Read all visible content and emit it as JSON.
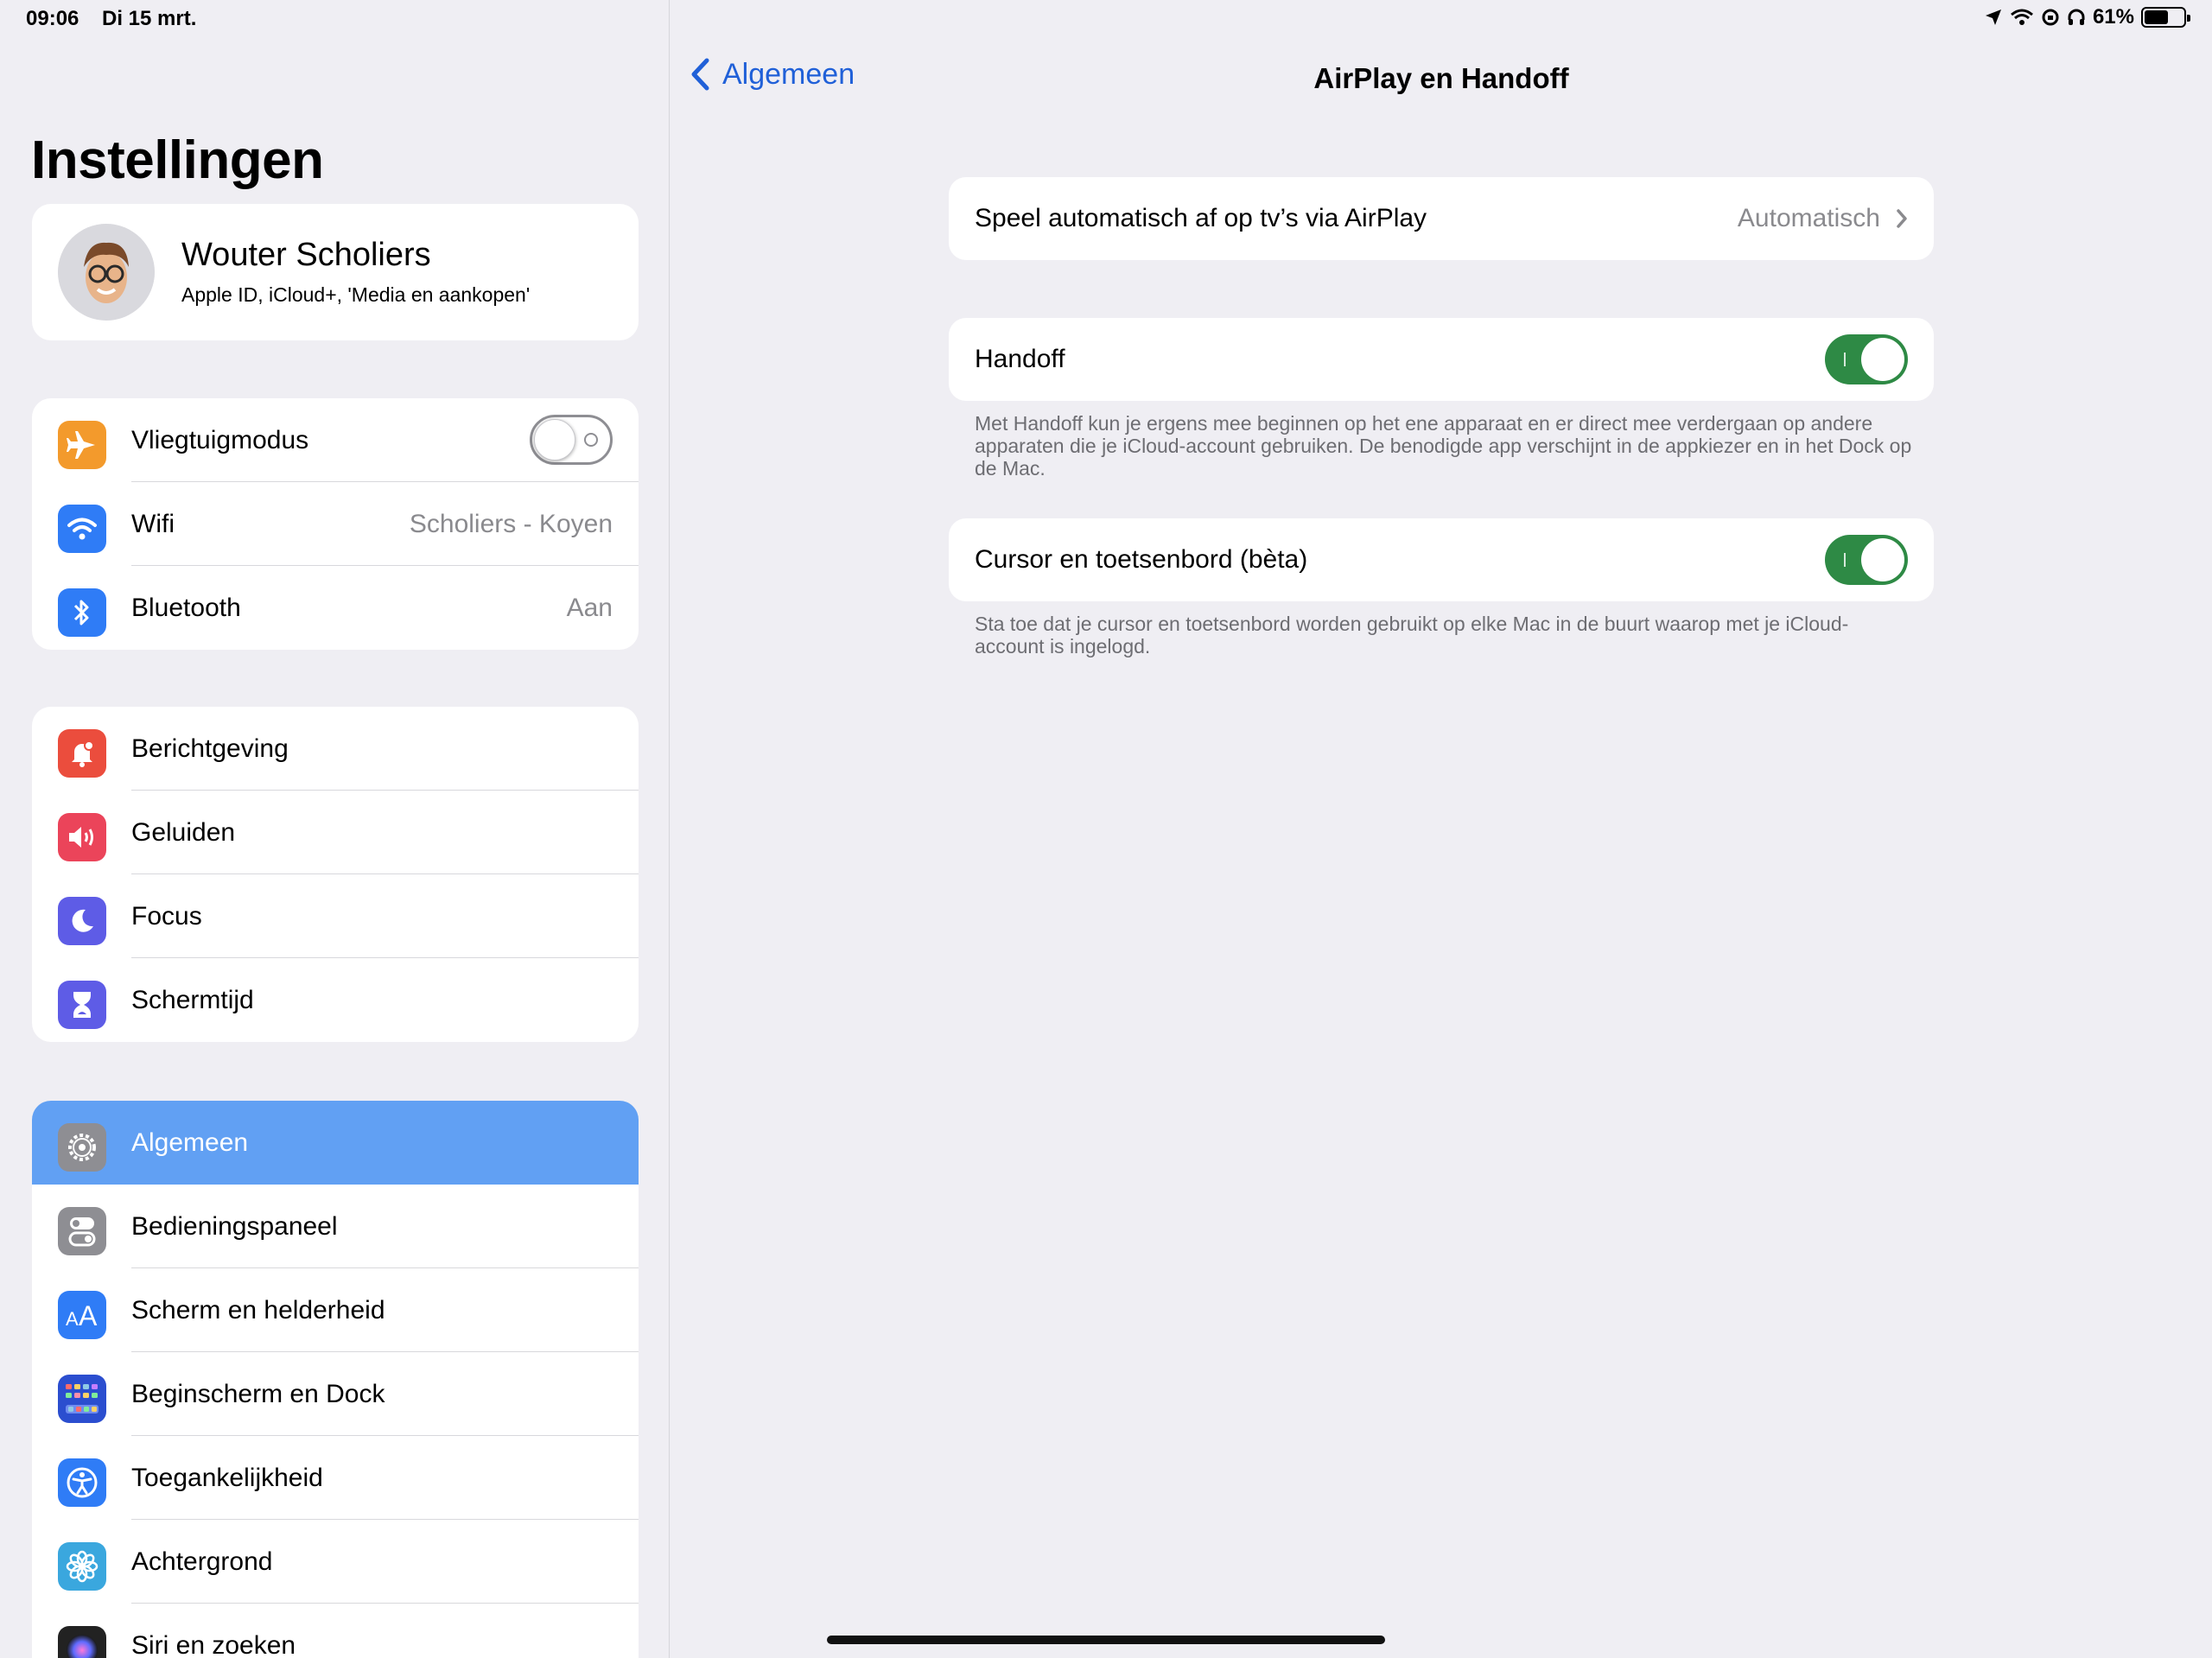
{
  "status": {
    "time": "09:06",
    "date": "Di 15 mrt.",
    "battery_percent": "61%",
    "battery_level": 0.61
  },
  "sidebar": {
    "title": "Instellingen",
    "profile": {
      "name": "Wouter Scholiers",
      "subtitle": "Apple ID, iCloud+, 'Media en aankopen'"
    },
    "group1": [
      {
        "label": "Vliegtuigmodus",
        "value": "",
        "icon": "airplane-icon",
        "color": "#f39a2c"
      },
      {
        "label": "Wifi",
        "value": "Scholiers - Koyen",
        "icon": "wifi-icon",
        "color": "#2f7cf6"
      },
      {
        "label": "Bluetooth",
        "value": "Aan",
        "icon": "bluetooth-icon",
        "color": "#2f7cf6"
      }
    ],
    "group2": [
      {
        "label": "Berichtgeving",
        "icon": "bell-icon",
        "color": "#eb4d3d"
      },
      {
        "label": "Geluiden",
        "icon": "speaker-icon",
        "color": "#eb445a"
      },
      {
        "label": "Focus",
        "icon": "moon-icon",
        "color": "#5e5ce6"
      },
      {
        "label": "Schermtijd",
        "icon": "hourglass-icon",
        "color": "#5e5ce6"
      }
    ],
    "group3": [
      {
        "label": "Algemeen",
        "icon": "gear-icon",
        "color": "#8e8e93"
      },
      {
        "label": "Bedieningspaneel",
        "icon": "switches-icon",
        "color": "#8e8e93"
      },
      {
        "label": "Scherm en helderheid",
        "icon": "text-size-icon",
        "color": "#2f7cf6"
      },
      {
        "label": "Beginscherm en Dock",
        "icon": "home-grid-icon",
        "color": "#2b4ecf"
      },
      {
        "label": "Toegankelijkheid",
        "icon": "accessibility-icon",
        "color": "#2f7cf6"
      },
      {
        "label": "Achtergrond",
        "icon": "flower-icon",
        "color": "#3aa7de"
      },
      {
        "label": "Siri en zoeken",
        "icon": "siri-icon",
        "color": "#222222"
      }
    ]
  },
  "detail": {
    "back_label": "Algemeen",
    "title": "AirPlay en Handoff",
    "airplay": {
      "label": "Speel automatisch af op tv’s via AirPlay",
      "value": "Automatisch"
    },
    "handoff": {
      "label": "Handoff",
      "enabled": true,
      "footnote": "Met Handoff kun je ergens mee beginnen op het ene apparaat en er direct mee verdergaan op andere apparaten die je iCloud-account gebruiken. De benodigde app verschijnt in de appkiezer en in het Dock op de Mac."
    },
    "cursor": {
      "label": "Cursor en toetsenbord (bèta)",
      "enabled": true,
      "footnote": "Sta toe dat je cursor en toetsenbord worden gebruikt op elke Mac in de buurt waarop met je iCloud-account is ingelogd."
    }
  }
}
